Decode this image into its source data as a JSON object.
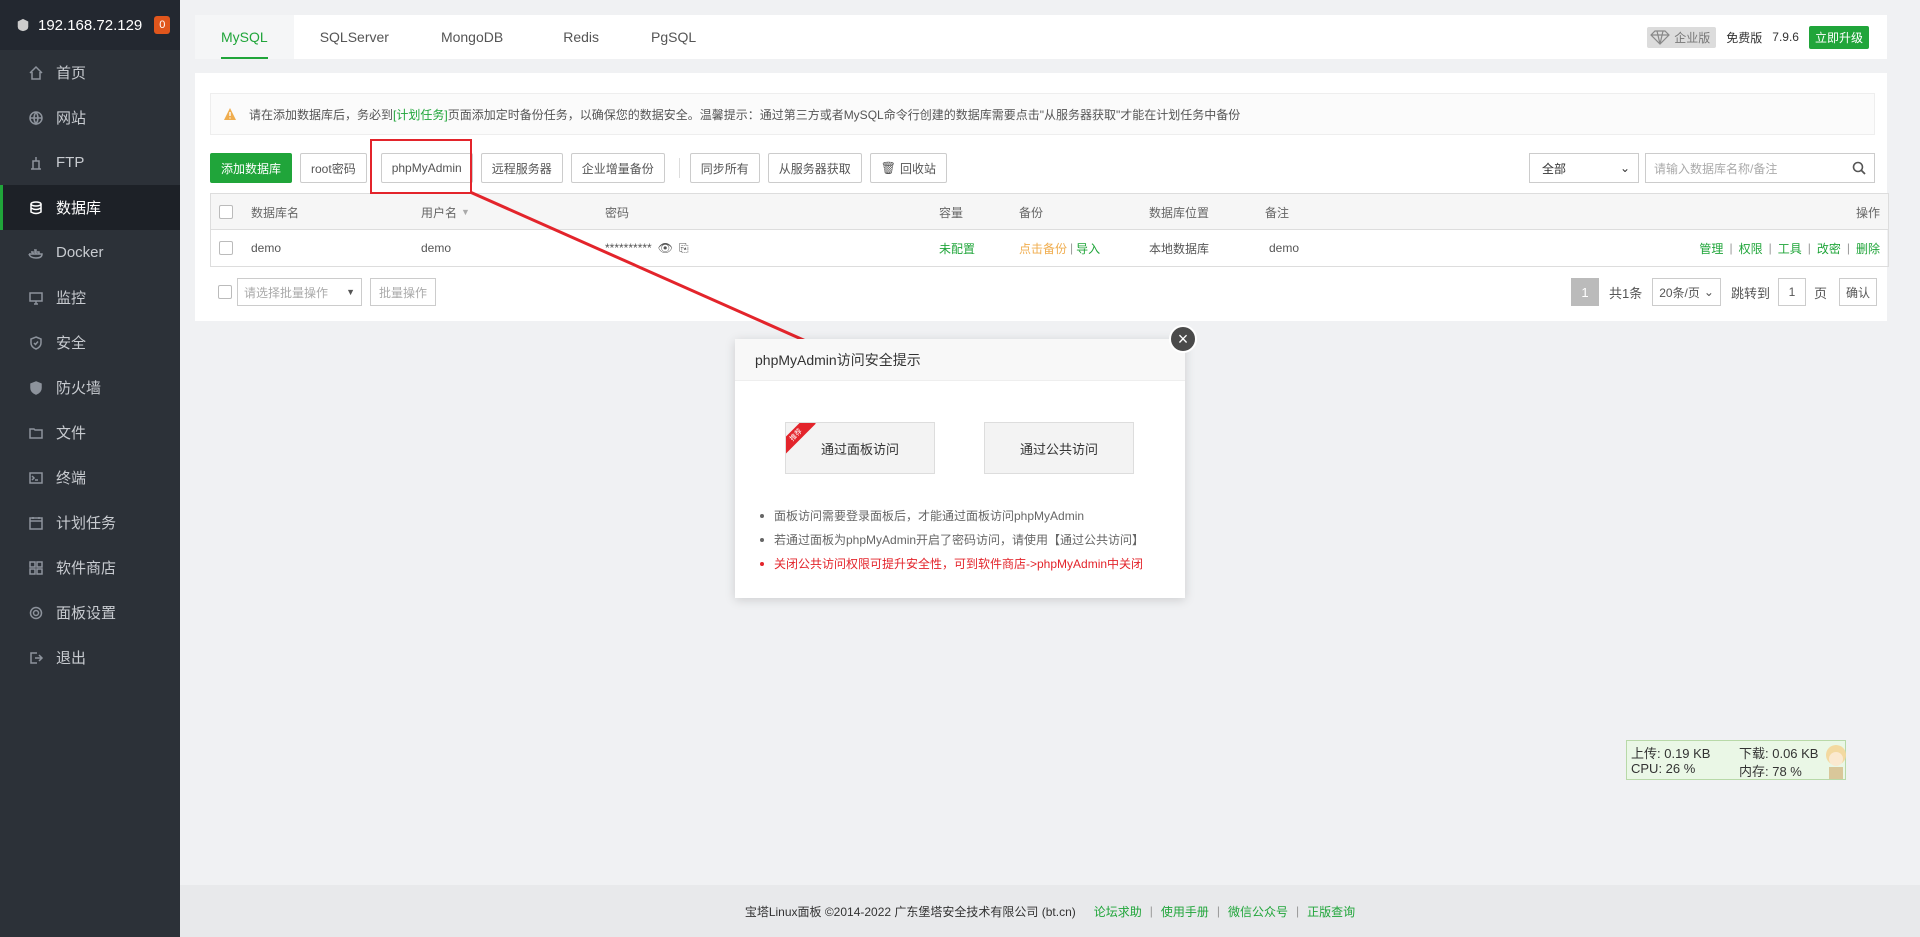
{
  "server": {
    "ip": "192.168.72.129",
    "badge": "0"
  },
  "sidebar": {
    "items": [
      {
        "label": "首页",
        "icon": "home-icon"
      },
      {
        "label": "网站",
        "icon": "globe-icon"
      },
      {
        "label": "FTP",
        "icon": "ftp-icon"
      },
      {
        "label": "数据库",
        "icon": "database-icon"
      },
      {
        "label": "Docker",
        "icon": "docker-icon"
      },
      {
        "label": "监控",
        "icon": "monitor-icon"
      },
      {
        "label": "安全",
        "icon": "shield-icon"
      },
      {
        "label": "防火墙",
        "icon": "firewall-icon"
      },
      {
        "label": "文件",
        "icon": "folder-icon"
      },
      {
        "label": "终端",
        "icon": "terminal-icon"
      },
      {
        "label": "计划任务",
        "icon": "calendar-icon"
      },
      {
        "label": "软件商店",
        "icon": "grid-icon"
      },
      {
        "label": "面板设置",
        "icon": "gear-icon"
      },
      {
        "label": "退出",
        "icon": "logout-icon"
      }
    ]
  },
  "tabs": [
    "MySQL",
    "SQLServer",
    "MongoDB",
    "Redis",
    "PgSQL"
  ],
  "topright": {
    "enterprise": "企业版",
    "free": "免费版",
    "version": "7.9.6",
    "upgrade": "立即升级"
  },
  "notice": {
    "pre": "请在添加数据库后，务必到",
    "link": "[计划任务]",
    "post": "页面添加定时备份任务，以确保您的数据安全。温馨提示：通过第三方或者MySQL命令行创建的数据库需要点击\"从服务器获取\"才能在计划任务中备份"
  },
  "toolbar": {
    "add": "添加数据库",
    "root": "root密码",
    "pma": "phpMyAdmin",
    "remote": "远程服务器",
    "incremental": "企业增量备份",
    "sync": "同步所有",
    "fetch": "从服务器获取",
    "recycle": "回收站"
  },
  "filter": {
    "select": "全部",
    "search_placeholder": "请输入数据库名称/备注"
  },
  "table": {
    "headers": {
      "name": "数据库名",
      "user": "用户名",
      "password": "密码",
      "capacity": "容量",
      "backup": "备份",
      "location": "数据库位置",
      "remark": "备注",
      "ops": "操作"
    },
    "row": {
      "name": "demo",
      "user": "demo",
      "password": "**********",
      "capacity": "未配置",
      "backup_click": "点击备份",
      "backup_import": "导入",
      "location": "本地数据库",
      "remark": "demo",
      "ops": [
        "管理",
        "权限",
        "工具",
        "改密",
        "删除"
      ]
    }
  },
  "batch": {
    "select": "请选择批量操作",
    "button": "批量操作"
  },
  "pager": {
    "current": "1",
    "total": "共1条",
    "size": "20条/页",
    "jump": "跳转到",
    "page_input": "1",
    "page_unit": "页",
    "confirm": "确认"
  },
  "modal": {
    "title": "phpMyAdmin访问安全提示",
    "option_panel": "通过面板访问",
    "ribbon": "推荐",
    "option_public": "通过公共访问",
    "notes": [
      "面板访问需要登录面板后，才能通过面板访问phpMyAdmin",
      "若通过面板为phpMyAdmin开启了密码访问，请使用【通过公共访问】",
      "关闭公共访问权限可提升安全性，可到软件商店->phpMyAdmin中关闭"
    ]
  },
  "speed": {
    "up": "上传: 0.19 KB",
    "down": "下载: 0.06 KB",
    "cpu": "CPU: 26 %",
    "mem": "内存: 78 %"
  },
  "footer": {
    "copyright": "宝塔Linux面板 ©2014-2022 广东堡塔安全技术有限公司 (bt.cn)",
    "links": [
      "论坛求助",
      "使用手册",
      "微信公众号",
      "正版查询"
    ]
  },
  "colors": {
    "accent": "#20a53a",
    "highlight": "#e3242b",
    "sidebar": "#2c3138"
  }
}
